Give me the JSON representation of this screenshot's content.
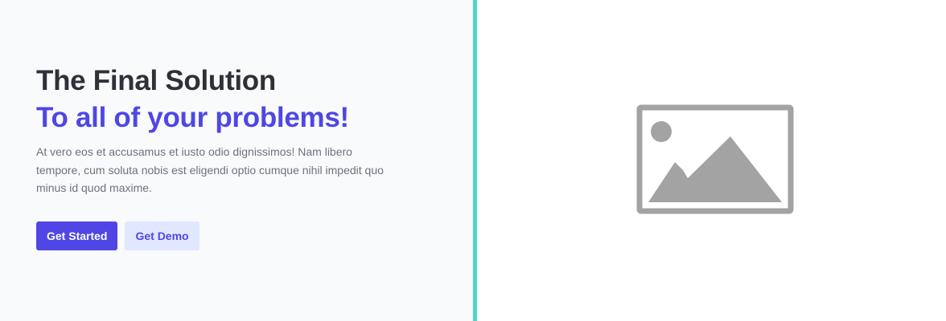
{
  "hero": {
    "title": "The Final Solution",
    "subtitle": "To all of your problems!",
    "description": "At vero eos et accusamus et iusto odio dignissimos! Nam libero tempore, cum soluta nobis est eligendi optio cumque nihil impedit quo minus id quod maxime.",
    "primary_button_label": "Get Started",
    "secondary_button_label": "Get Demo"
  },
  "media": {
    "icon": "image-placeholder-icon"
  },
  "colors": {
    "accent": "#4f46e5",
    "accent_light": "#e0e7ff",
    "divider": "#4fd8c6",
    "heading": "#2d3138",
    "body_text": "#6b7280",
    "placeholder_gray": "#a3a3a3"
  }
}
